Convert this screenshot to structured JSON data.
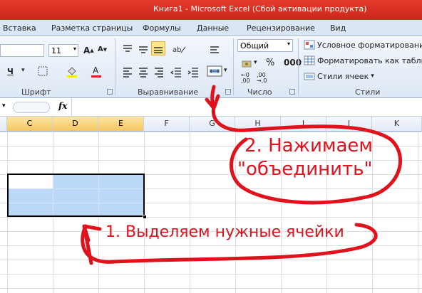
{
  "window": {
    "title": "Книга1  -  Microsoft Excel (Сбой активации продукта)"
  },
  "tabs": [
    "Вставка",
    "Разметка страницы",
    "Формулы",
    "Данные",
    "Рецензирование",
    "Вид"
  ],
  "ribbon": {
    "font_size": "11",
    "number_format": "Общий",
    "groups": {
      "font": "Шрифт",
      "alignment": "Выравнивание",
      "number": "Число",
      "styles": "Стили"
    },
    "styles_buttons": [
      "Условное форматирование",
      "Форматировать как таблицу",
      "Стили ячеек"
    ]
  },
  "formula_bar": {
    "fx": "fx"
  },
  "columns": [
    "C",
    "D",
    "E",
    "F",
    "G",
    "H",
    "I",
    "J",
    "K"
  ],
  "annotations": {
    "step1": "1. Выделяем нужные ячейки",
    "step2_line1": "2. Нажимаем",
    "step2_line2": "\"объединить\""
  },
  "colors": {
    "title_bar": "#d9322a",
    "selection": "#bcd8f8",
    "annotation": "#e0121b"
  }
}
